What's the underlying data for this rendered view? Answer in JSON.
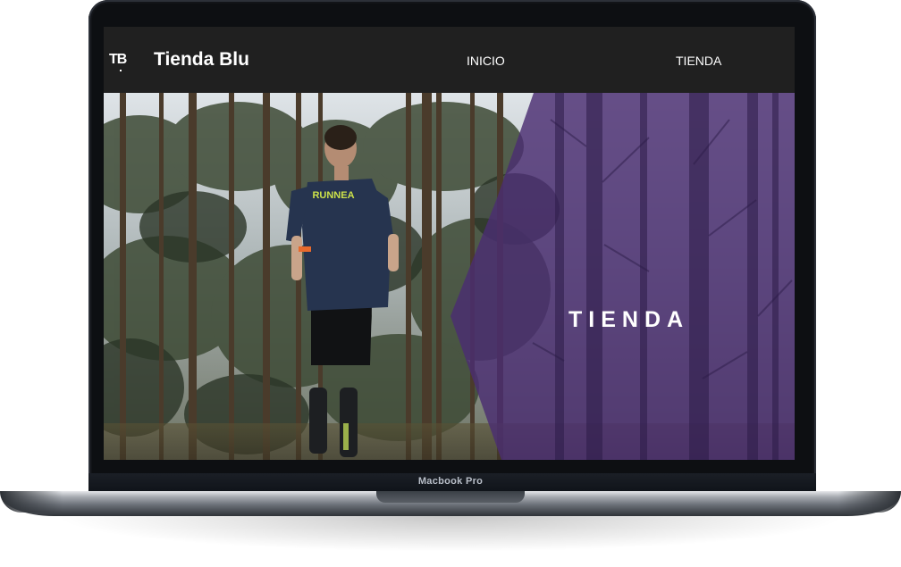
{
  "device": {
    "label": "Macbook Pro"
  },
  "navbar": {
    "logo_text": "TB",
    "brand": "Tienda Blu",
    "links": [
      {
        "label": "INICIO"
      },
      {
        "label": "TIENDA"
      }
    ]
  },
  "hero": {
    "title": "TIENDA",
    "shirt_text": "RUNNEA",
    "overlay_color": "#4a2d72"
  }
}
